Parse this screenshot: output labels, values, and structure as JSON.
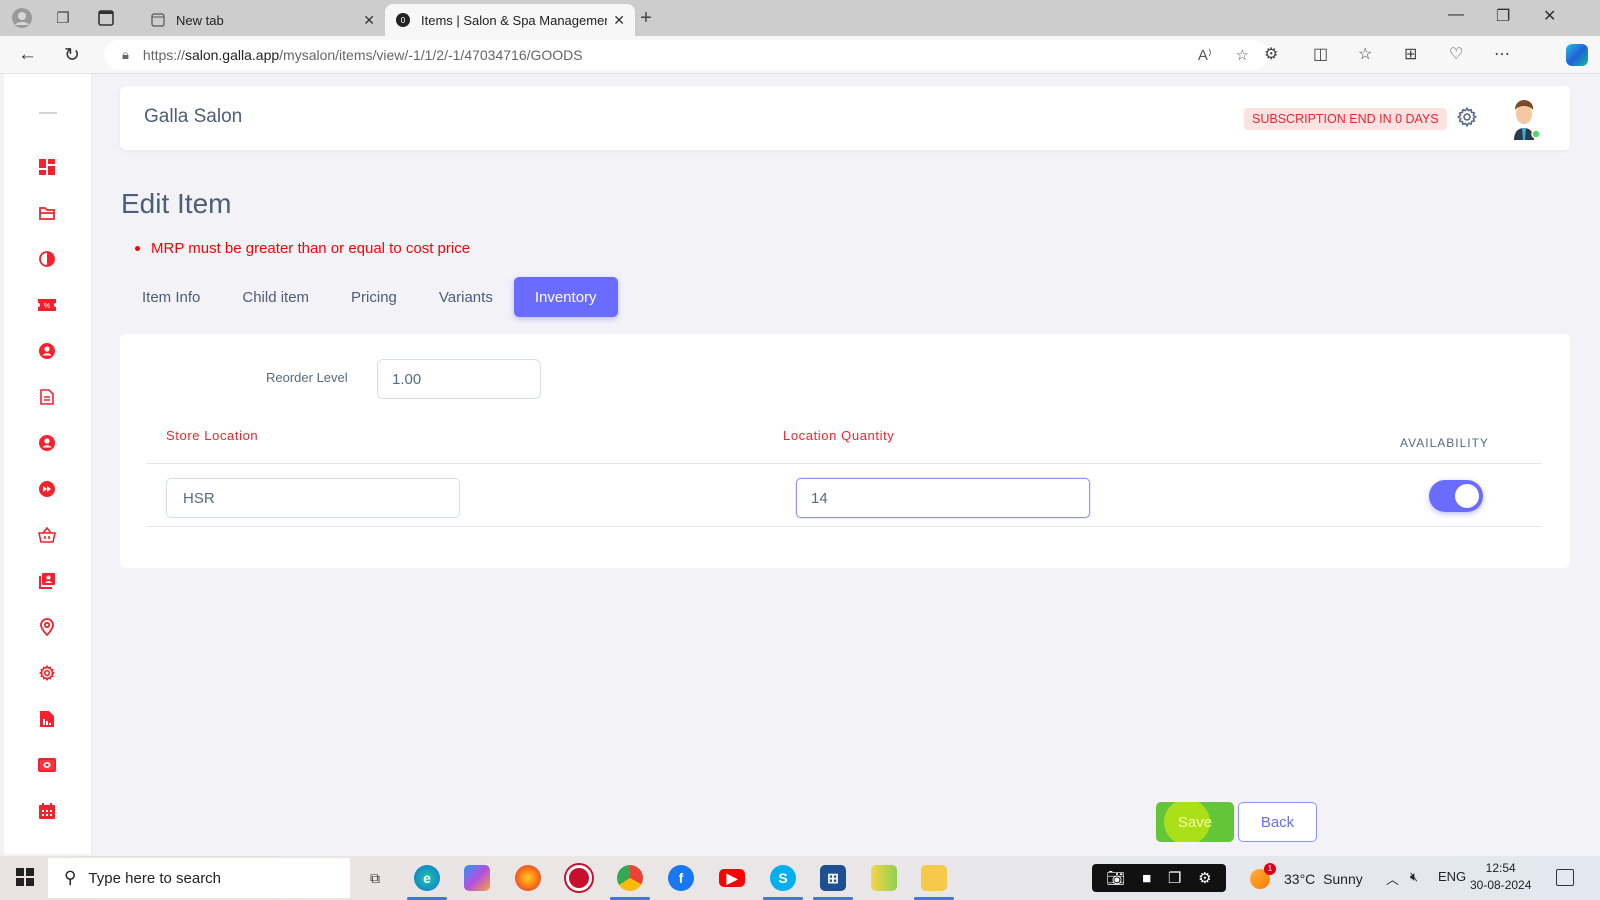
{
  "browser": {
    "tabs": [
      {
        "title": "New tab",
        "active": false
      },
      {
        "title": "Items | Salon & Spa Management",
        "active": true
      }
    ],
    "url_prefix": "https://",
    "url_host": "salon.galla.app",
    "url_path": "/mysalon/items/view/-1/1/2/-1/47034716/GOODS"
  },
  "sidebar": {
    "items": [
      {
        "icon": "dashboard-icon"
      },
      {
        "icon": "folder-icon"
      },
      {
        "icon": "contrast-icon"
      },
      {
        "icon": "discount-ticket-icon"
      },
      {
        "icon": "user-circle-icon"
      },
      {
        "icon": "document-icon"
      },
      {
        "icon": "user-circle-icon"
      },
      {
        "icon": "fast-forward-icon"
      },
      {
        "icon": "basket-icon"
      },
      {
        "icon": "contacts-icon"
      },
      {
        "icon": "location-pin-icon"
      },
      {
        "icon": "settings-icon"
      },
      {
        "icon": "report-icon"
      },
      {
        "icon": "cash-icon"
      },
      {
        "icon": "calendar-icon"
      }
    ]
  },
  "header": {
    "brand": "Galla Salon",
    "subscription_badge": "SUBSCRIPTION END IN 0 DAYS"
  },
  "page": {
    "title": "Edit Item",
    "errors": [
      "MRP must be greater than or equal to cost price"
    ],
    "tabs": [
      {
        "label": "Item Info",
        "active": false
      },
      {
        "label": "Child item",
        "active": false
      },
      {
        "label": "Pricing",
        "active": false
      },
      {
        "label": "Variants",
        "active": false
      },
      {
        "label": "Inventory",
        "active": true
      }
    ]
  },
  "inventory": {
    "reorder_label": "Reorder Level",
    "reorder_value": "1.00",
    "columns": {
      "store_location": "Store Location",
      "location_quantity": "Location Quantity",
      "availability": "AVAILABILITY"
    },
    "rows": [
      {
        "store": "HSR",
        "quantity": "14",
        "available": true
      }
    ]
  },
  "actions": {
    "save": "Save",
    "back": "Back"
  },
  "taskbar": {
    "search_placeholder": "Type here to search",
    "weather_temp": "33°C",
    "weather_desc": "Sunny",
    "weather_badge": "1",
    "language": "ENG",
    "time": "12:54",
    "date": "30-08-2024"
  },
  "colors": {
    "accent": "#696cff",
    "error": "#f5222d",
    "save": "#63c53a"
  }
}
